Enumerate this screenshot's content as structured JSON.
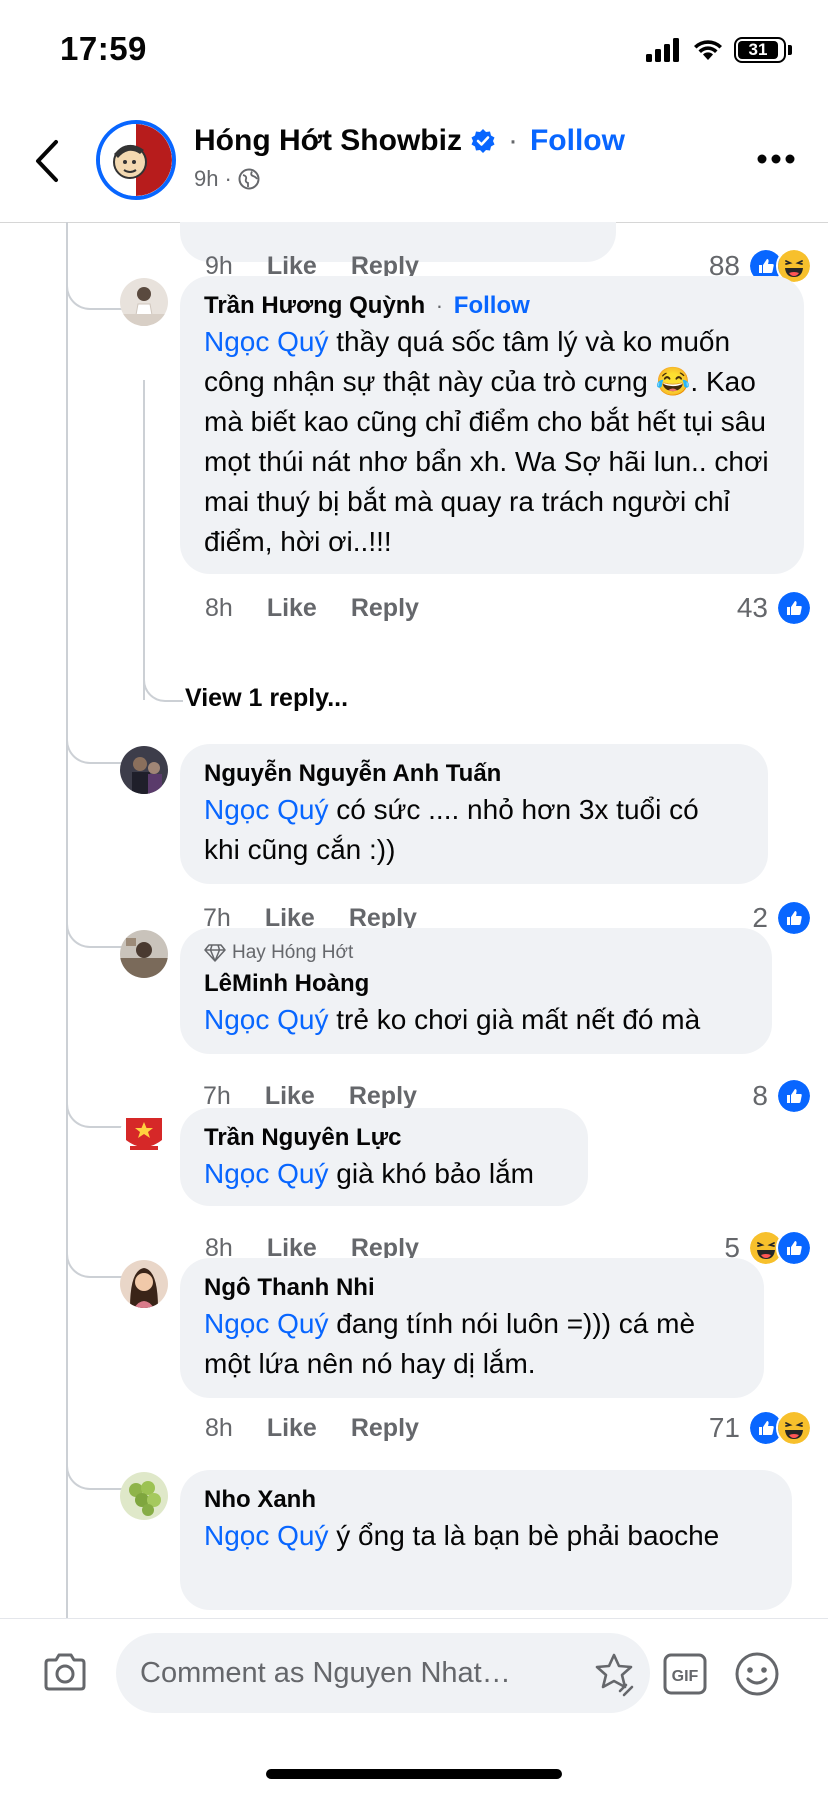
{
  "status_bar": {
    "time": "17:59",
    "battery": "31"
  },
  "header": {
    "page_name": "Hóng Hớt Showbiz",
    "separator": "·",
    "follow_label": "Follow",
    "post_time": "9h",
    "separator_small": "·"
  },
  "top_comment_actions": {
    "time": "9h",
    "like": "Like",
    "reply": "Reply",
    "reaction_count": "88"
  },
  "comments": [
    {
      "author": "Trần Hương Quỳnh",
      "follow_label": "Follow",
      "mention": "Ngọc Quý",
      "text": " thầy quá sốc tâm lý và ko muốn công nhận sự thật này của trò cưng 😂. Kao mà biết kao cũng chỉ điểm cho bắt hết tụi sâu mọt thúi nát nhơ bẩn xh. Wa Sợ hãi lun.. chơi mai thuý bị bắt mà quay ra trách người chỉ điểm, hời ơi..!!!",
      "time": "8h",
      "like": "Like",
      "reply": "Reply",
      "reaction_count": "43"
    },
    {
      "author": "Nguyễn Nguyễn Anh Tuấn",
      "mention": "Ngọc Quý",
      "text": " có sức .... nhỏ hơn 3x tuổi có khi cũng cắn :))",
      "time": "7h",
      "like": "Like",
      "reply": "Reply",
      "reaction_count": "2"
    },
    {
      "badge": "Hay Hóng Hớt",
      "author": "LêMinh Hoàng",
      "mention": "Ngọc Quý",
      "text": " trẻ ko chơi già mất nết đó mà",
      "time": "7h",
      "like": "Like",
      "reply": "Reply",
      "reaction_count": "8"
    },
    {
      "author": "Trần Nguyên Lực",
      "mention": "Ngọc Quý",
      "text": " già khó bảo lắm",
      "time": "8h",
      "like": "Like",
      "reply": "Reply",
      "reaction_count": "5"
    },
    {
      "author": "Ngô Thanh Nhi",
      "mention": "Ngọc Quý",
      "text": " đang tính nói luôn =))) cá mè một lứa nên nó hay dị lắm.",
      "time": "8h",
      "like": "Like",
      "reply": "Reply",
      "reaction_count": "71"
    },
    {
      "author": "Nho Xanh",
      "mention": "Ngọc Quý",
      "text": " ý ổng ta là bạn bè phải baoche"
    }
  ],
  "view_replies": "View 1 reply...",
  "composer": {
    "placeholder": "Comment as Nguyen Nhat…",
    "gif_label": "GIF"
  },
  "colors": {
    "accent": "#0866ff",
    "bubble": "#f0f2f5",
    "secondary_text": "#65676b"
  },
  "icons": [
    "back-arrow-icon",
    "verified-badge-icon",
    "globe-icon",
    "more-options-icon",
    "like-reaction-icon",
    "haha-reaction-icon",
    "diamond-icon",
    "camera-icon",
    "avatar-sticker-icon",
    "gif-icon",
    "emoji-icon"
  ]
}
